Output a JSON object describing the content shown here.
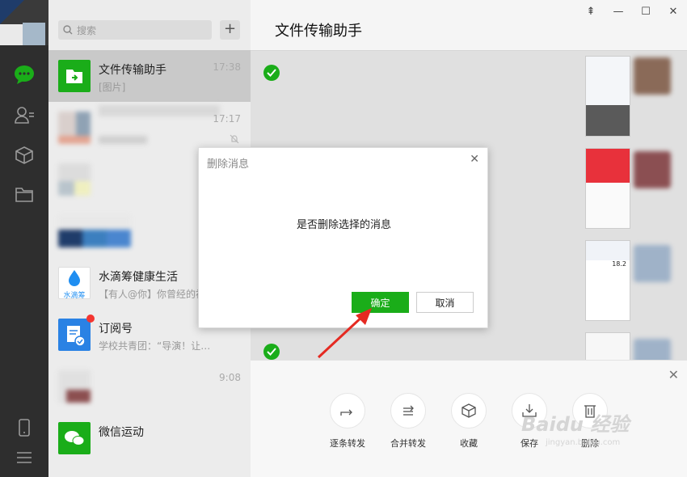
{
  "sidebar": {
    "icons": [
      "chat-icon",
      "contacts-icon",
      "box-icon",
      "folder-icon",
      "phone-icon",
      "menu-icon"
    ],
    "accent": "#1aad19"
  },
  "search": {
    "placeholder": "搜索",
    "add_label": "+"
  },
  "chats": [
    {
      "name": "文件传输助手",
      "preview": "[图片]",
      "time": "17:38"
    },
    {
      "name": "",
      "preview": "",
      "time": "17:17"
    },
    {
      "name": "",
      "preview": "",
      "time": ""
    },
    {
      "name": "",
      "preview": "",
      "time": ""
    },
    {
      "name": "水滴筹健康生活",
      "preview": "【有人@你】你曾经的初",
      "time": "",
      "avatar_text": "水滴筹"
    },
    {
      "name": "订阅号",
      "preview": "学校共青团：“导演！让…",
      "time": ""
    },
    {
      "name": "",
      "preview": "",
      "time": "9:08"
    },
    {
      "name": "微信运动",
      "preview": "",
      "time": ""
    }
  ],
  "main": {
    "title": "文件传输助手",
    "window_controls": [
      "⇞",
      "—",
      "☐",
      "✕"
    ],
    "shot_fragments": [
      "18.2"
    ]
  },
  "actions": [
    {
      "label": "逐条转发",
      "icon": "forward-icon"
    },
    {
      "label": "合并转发",
      "icon": "merge-forward-icon"
    },
    {
      "label": "收藏",
      "icon": "favorite-icon"
    },
    {
      "label": "保存",
      "icon": "save-icon"
    },
    {
      "label": "删除",
      "icon": "delete-icon"
    }
  ],
  "dialog": {
    "title": "删除消息",
    "message": "是否删除选择的消息",
    "ok_label": "确定",
    "cancel_label": "取消"
  },
  "watermark": {
    "main": "Baidu 经验",
    "sub": "jingyan.baidu.com"
  }
}
